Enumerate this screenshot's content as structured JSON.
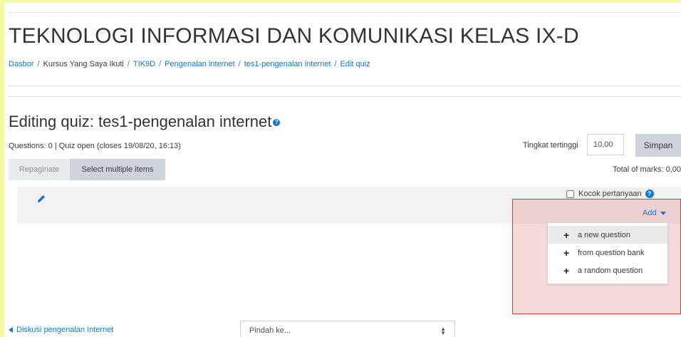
{
  "header": {
    "course_title": "TEKNOLOGI INFORMASI DAN KOMUNIKASI KELAS IX-D",
    "breadcrumb": [
      {
        "label": "Dasbor",
        "link": true
      },
      {
        "label": "Kursus Yang Saya Ikuti",
        "link": false
      },
      {
        "label": "TIK9D",
        "link": true
      },
      {
        "label": "Pengenalan internet",
        "link": true
      },
      {
        "label": "tes1-pengenalan internet",
        "link": true
      },
      {
        "label": "Edit quiz",
        "link": true
      }
    ],
    "separator": "/"
  },
  "main": {
    "title": "Editing quiz: tes1-pengenalan internet",
    "quiz_info": "Questions: 0 | Quiz open (closes 19/08/20, 16:13)",
    "max_grade_label": "Tingkat tertinggi",
    "max_grade_value": "10,00",
    "save_label": "Simpan",
    "repaginate_label": "Repaginate",
    "select_multiple_label": "Select multiple items",
    "total_marks": "Total of marks: 0,00",
    "shuffle_label": "Kocok pertanyaan",
    "add_label": "Add",
    "add_menu": [
      {
        "label": "a new question",
        "icon": "plus-icon"
      },
      {
        "label": "from question bank",
        "icon": "plus-icon"
      },
      {
        "label": "a random question",
        "icon": "plus-icon"
      }
    ]
  },
  "footer": {
    "prev_activity": "Diskusi pengenalan Internet",
    "jump_placeholder": "Pindah ke..."
  },
  "colors": {
    "link": "#1177d1",
    "highlight_border": "#d93b3b",
    "page_border": "#f5f9a0"
  }
}
